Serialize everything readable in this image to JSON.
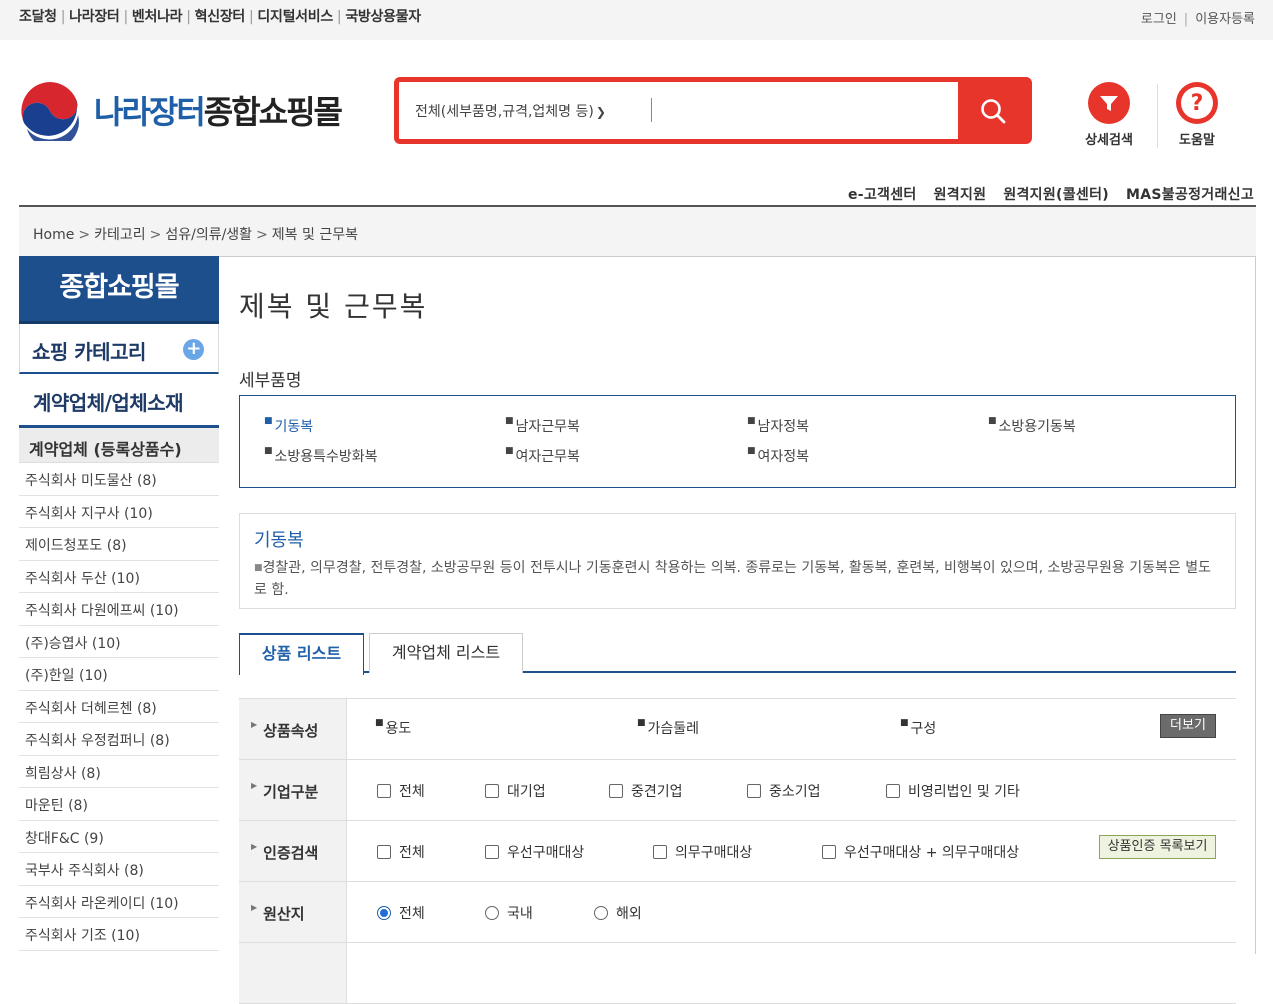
{
  "top_links": [
    "조달청",
    "나라장터",
    "벤처나라",
    "혁신장터",
    "디지털서비스",
    "국방상용물자"
  ],
  "user_links": {
    "login": "로그인",
    "register": "이용자등록"
  },
  "logo": {
    "part1": "나라장터",
    "part2": "종합쇼핑몰"
  },
  "search": {
    "category": "전체(세부품명,규격,업체명 등)",
    "value": ""
  },
  "header_buttons": {
    "detail_search": "상세검색",
    "help": "도움말"
  },
  "sub_nav": [
    "e-고객센터",
    "원격지원",
    "원격지원(콜센터)",
    "MAS불공정거래신고"
  ],
  "breadcrumb": [
    "Home",
    "카테고리",
    "섬유/의류/생활",
    "제복 및 근무복"
  ],
  "sidebar": {
    "title": "종합쇼핑몰",
    "category_label": "쇼핑 카테고리",
    "vendor_label": "계약업체/업체소재",
    "vendor_header": "계약업체 (등록상품수)",
    "vendors": [
      "주식회사 미도물산 (8)",
      "주식회사 지구사 (10)",
      "제이드청포도 (8)",
      "주식회사 두산 (10)",
      "주식회사 다원에프씨 (10)",
      "(주)승엽사 (10)",
      "(주)한일 (10)",
      "주식회사 더헤르첸 (8)",
      "주식회사 우정컴퍼니 (8)",
      "희림상사 (8)",
      "마운틴 (8)",
      "창대F&C (9)",
      "국부사 주식회사 (8)",
      "주식회사 라온케이디 (10)",
      "주식회사 기조 (10)"
    ]
  },
  "main": {
    "title": "제복 및 근무복",
    "detail_label": "세부품명",
    "detail_items": [
      "기동복",
      "남자근무복",
      "남자정복",
      "소방용기동복",
      "소방용특수방화복",
      "여자근무복",
      "여자정복"
    ],
    "desc_title": "기동복",
    "desc_text": "경찰관, 의무경찰, 전투경찰, 소방공무원 등이 전투시나 기동훈련시 착용하는 의복. 종류로는 기동복, 활동복, 훈련복, 비행복이 있으며, 소방공무원용 기동복은 별도로 함.",
    "tabs": [
      "상품 리스트",
      "계약업체 리스트"
    ],
    "filters": {
      "attr_label": "상품속성",
      "attrs": [
        "용도",
        "가슴둘레",
        "구성"
      ],
      "more": "더보기",
      "company_label": "기업구분",
      "company_opts": [
        "전체",
        "대기업",
        "중견기업",
        "중소기업",
        "비영리법인 및 기타"
      ],
      "cert_label": "인증검색",
      "cert_opts": [
        "전체",
        "우선구매대상",
        "의무구매대상",
        "우선구매대상 + 의무구매대상"
      ],
      "cert_btn": "상품인증 목록보기",
      "origin_label": "원산지",
      "origin_opts": [
        "전체",
        "국내",
        "해외"
      ]
    }
  },
  "colors": {
    "brand_red": "#e8352b",
    "brand_blue": "#1e4f8d"
  }
}
